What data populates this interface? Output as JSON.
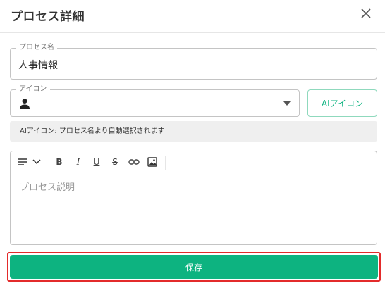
{
  "dialog": {
    "title": "プロセス詳細"
  },
  "form": {
    "name_label": "プロセス名",
    "name_value": "人事情報",
    "icon_label": "アイコン",
    "icon_selected": "person-icon",
    "ai_button_label": "AIアイコン",
    "info_text": "AIアイコン: プロセス名より自動選択されます"
  },
  "editor": {
    "toolbar": [
      "align-menu-icon",
      "chevron-down-icon",
      "bold-icon",
      "italic-icon",
      "underline-icon",
      "strikethrough-icon",
      "link-icon",
      "image-icon"
    ],
    "bold": "B",
    "italic": "I",
    "underline": "U",
    "strike": "S",
    "placeholder": "プロセス説明"
  },
  "actions": {
    "save_label": "保存"
  },
  "colors": {
    "accent": "#0db380",
    "highlight": "#e32b2b"
  }
}
